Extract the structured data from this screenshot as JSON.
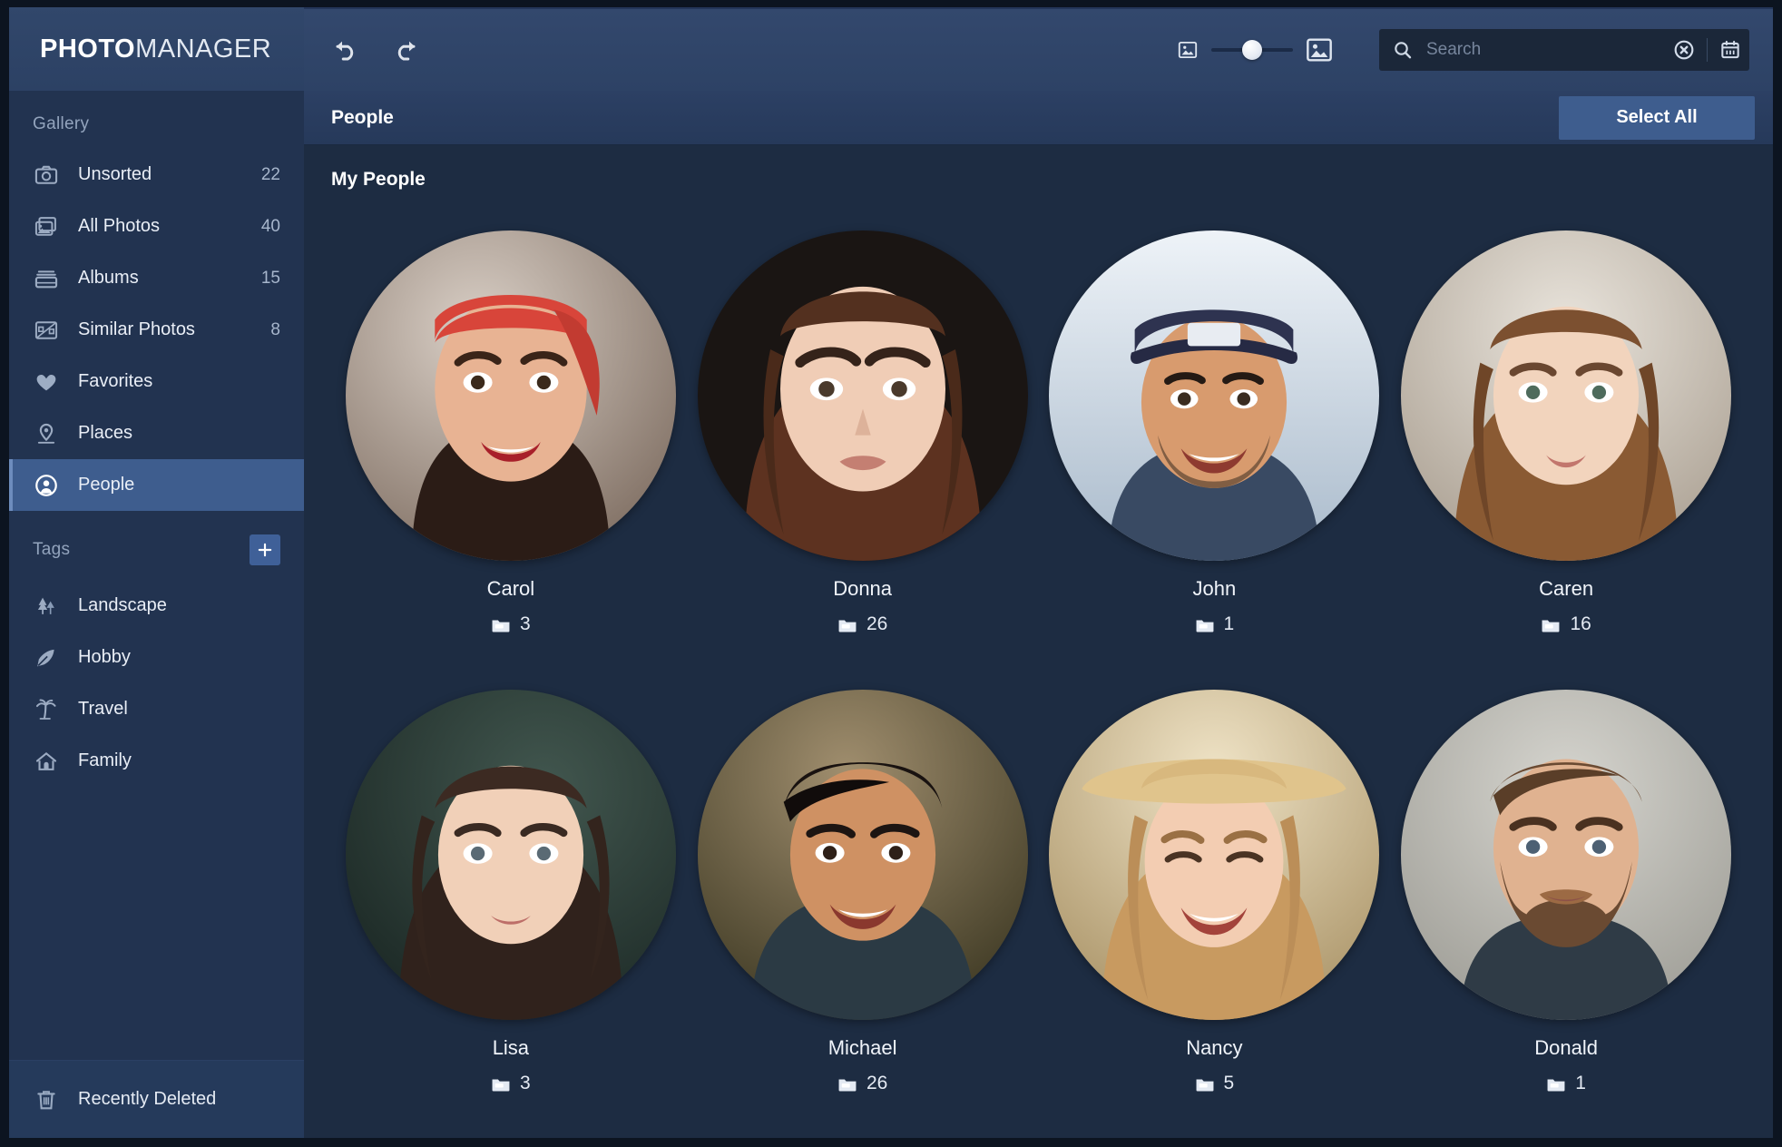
{
  "app": {
    "brand_bold": "PHOTO",
    "brand_light": "MANAGER",
    "accent": "#3e5d8e",
    "sidebar_bg": "#223350",
    "content_bg": "#1d2c42",
    "topbar_bg": "#2d4265"
  },
  "toolbar": {
    "undo_icon": "undo-icon",
    "redo_icon": "redo-icon",
    "zoom_small_icon": "small-thumbnail-icon",
    "zoom_large_icon": "large-thumbnail-icon",
    "zoom_value": "50"
  },
  "search": {
    "icon": "search-icon",
    "placeholder": "Search",
    "value": "",
    "clear_icon": "clear-circle-icon",
    "calendar_icon": "calendar-icon"
  },
  "sidebar": {
    "gallery_label": "Gallery",
    "gallery_items": [
      {
        "label": "Unsorted",
        "count": "22",
        "icon": "camera-icon",
        "active": false
      },
      {
        "label": "All Photos",
        "count": "40",
        "icon": "photos-icon",
        "active": false
      },
      {
        "label": "Albums",
        "count": "15",
        "icon": "albums-icon",
        "active": false
      },
      {
        "label": "Similar Photos",
        "count": "8",
        "icon": "similar-photos-icon",
        "active": false
      },
      {
        "label": "Favorites",
        "count": "",
        "icon": "heart-icon",
        "active": false
      },
      {
        "label": "Places",
        "count": "",
        "icon": "location-pin-icon",
        "active": false
      },
      {
        "label": "People",
        "count": "",
        "icon": "person-circle-icon",
        "active": true
      }
    ],
    "tags_label": "Tags",
    "tags_add_icon": "plus-icon",
    "tag_items": [
      {
        "label": "Landscape",
        "icon": "trees-icon"
      },
      {
        "label": "Hobby",
        "icon": "feather-icon"
      },
      {
        "label": "Travel",
        "icon": "palm-tree-icon"
      },
      {
        "label": "Family",
        "icon": "house-icon"
      }
    ],
    "footer": {
      "label": "Recently Deleted",
      "icon": "trash-icon"
    }
  },
  "main": {
    "breadcrumb": "People",
    "select_all_label": "Select All",
    "section_title": "My People",
    "count_icon": "photo-stack-icon",
    "people": [
      {
        "name": "Carol",
        "count": "3",
        "skin": "#e8b393",
        "hair": "#3a2218",
        "bg1": "#d9cfc6",
        "bg2": "#8d7b6e",
        "accessory": "bandana",
        "acc_color": "#d8453a"
      },
      {
        "name": "Donna",
        "count": "26",
        "skin": "#f0cdb6",
        "hair": "#6b3a22",
        "bg1": "#2b2220",
        "bg2": "#14100f",
        "accessory": "none",
        "acc_color": "#000000"
      },
      {
        "name": "John",
        "count": "1",
        "skin": "#d89b6e",
        "hair": "#241a14",
        "bg1": "#e8edf2",
        "bg2": "#b9c6d4",
        "accessory": "cap",
        "acc_color": "#2e3350"
      },
      {
        "name": "Caren",
        "count": "16",
        "skin": "#f2d4bd",
        "hair": "#8a5a33",
        "bg1": "#e7e3dc",
        "bg2": "#b3a89b",
        "accessory": "none",
        "acc_color": "#000000"
      },
      {
        "name": "Lisa",
        "count": "3",
        "skin": "#f1d0b8",
        "hair": "#3c2a22",
        "bg1": "#3a4a46",
        "bg2": "#1d2a28",
        "accessory": "none",
        "acc_color": "#000000"
      },
      {
        "name": "Michael",
        "count": "26",
        "skin": "#cf9163",
        "hair": "#191210",
        "bg1": "#8a7a5e",
        "bg2": "#45402f",
        "accessory": "none",
        "acc_color": "#000000"
      },
      {
        "name": "Nancy",
        "count": "5",
        "skin": "#f3cdb2",
        "hair": "#c89a60",
        "bg1": "#e4d6b8",
        "bg2": "#b49a6c",
        "accessory": "hat",
        "acc_color": "#e0c48c"
      },
      {
        "name": "Donald",
        "count": "1",
        "skin": "#e0b290",
        "hair": "#6a4a32",
        "bg1": "#cfcec7",
        "bg2": "#a9a8a0",
        "accessory": "beard",
        "acc_color": "#6a4a32"
      }
    ]
  }
}
